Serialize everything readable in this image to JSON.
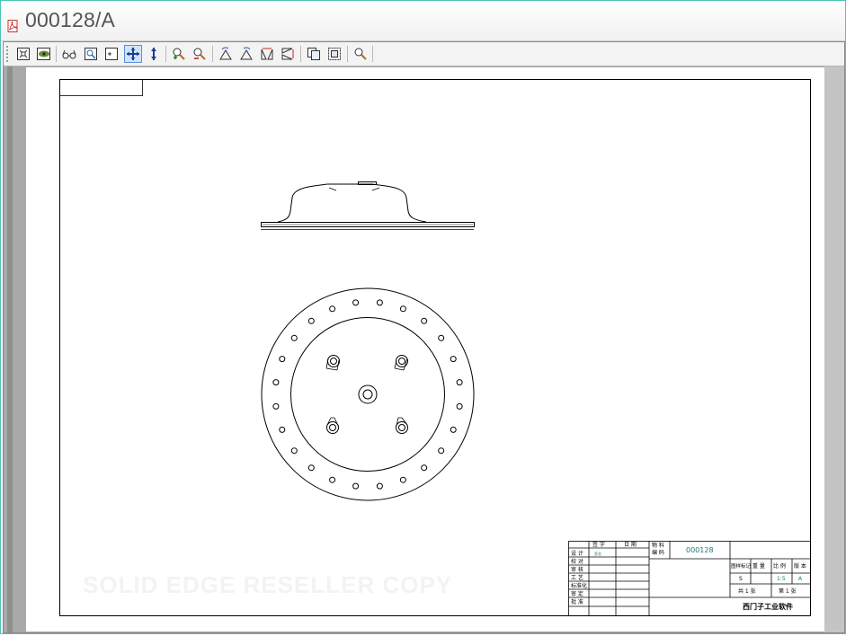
{
  "window": {
    "title": "000128/A"
  },
  "toolbar": {
    "buttons": [
      {
        "name": "fit-page-icon"
      },
      {
        "name": "view-icon"
      },
      {
        "name": "glasses-icon"
      },
      {
        "name": "zoom-window-icon"
      },
      {
        "name": "zoom-area-icon"
      },
      {
        "name": "pan-icon"
      },
      {
        "name": "vertical-pan-icon"
      },
      {
        "name": "zoom-in-icon"
      },
      {
        "name": "zoom-out-icon"
      },
      {
        "name": "rotate-left-icon"
      },
      {
        "name": "rotate-right-icon"
      },
      {
        "name": "flip-horizontal-icon"
      },
      {
        "name": "flip-vertical-icon"
      },
      {
        "name": "copy-icon"
      },
      {
        "name": "select-icon"
      },
      {
        "name": "search-icon"
      }
    ]
  },
  "watermark": "SOLID EDGE RESELLER COPY",
  "title_block": {
    "col_sign": "签 字",
    "col_date": "日 期",
    "material_code_label_1": "物 料",
    "material_code_label_2": "编 码",
    "part_number": "000128",
    "rows": [
      "设 计",
      "校 对",
      "审 核",
      "工 艺",
      "标准化",
      "审 定",
      "批 准"
    ],
    "designer_signature": "签名",
    "drawing_mark": "图样标记",
    "weight": "重 量",
    "scale_label": "比 例",
    "version": "版 本",
    "mark_value": "S",
    "scale_value": "1:5",
    "version_value": "A",
    "total_sheets": "共 1 张",
    "sheet_no": "第 1 张",
    "company": "西门子工业软件"
  }
}
